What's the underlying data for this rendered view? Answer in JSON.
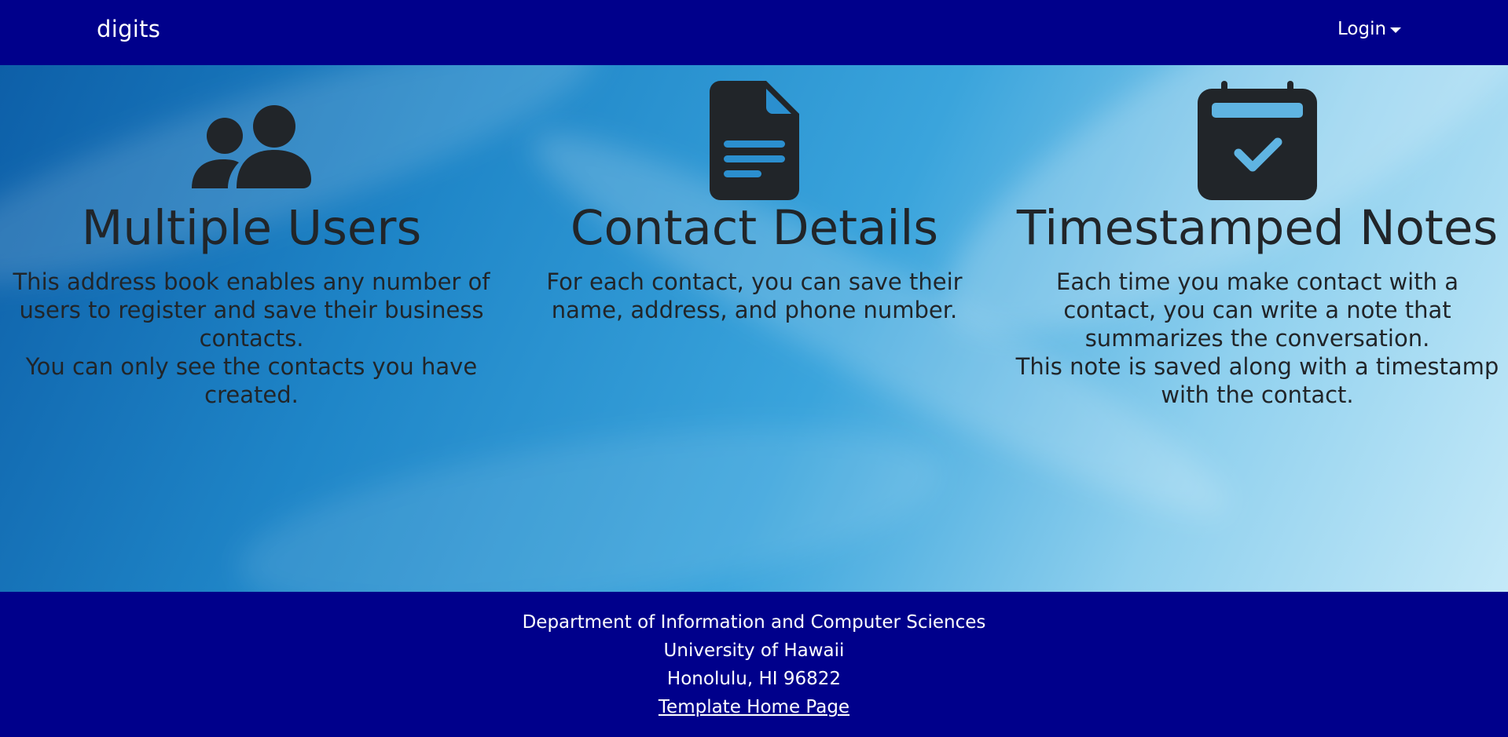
{
  "navbar": {
    "brand": "digits",
    "login_label": "Login",
    "background": "#00008b"
  },
  "features": [
    {
      "icon": "people-icon",
      "title": "Multiple Users",
      "lines": [
        "This address book enables any number of users to register and save their business contacts.",
        "You can only see the contacts you have created."
      ]
    },
    {
      "icon": "file-text-icon",
      "title": "Contact Details",
      "lines": [
        "For each contact, you can save their name, address, and phone number."
      ]
    },
    {
      "icon": "calendar-check-icon",
      "title": "Timestamped Notes",
      "lines": [
        "Each time you make contact with a contact, you can write a note that summarizes the conversation.",
        "This note is saved along with a timestamp with the contact."
      ]
    }
  ],
  "footer": {
    "line1": "Department of Information and Computer Sciences",
    "line2": "University of Hawaii",
    "line3": "Honolulu, HI 96822",
    "link_label": "Template Home Page",
    "background": "#00008b"
  },
  "colors": {
    "text": "#212529",
    "footer_text": "#ffffff"
  }
}
